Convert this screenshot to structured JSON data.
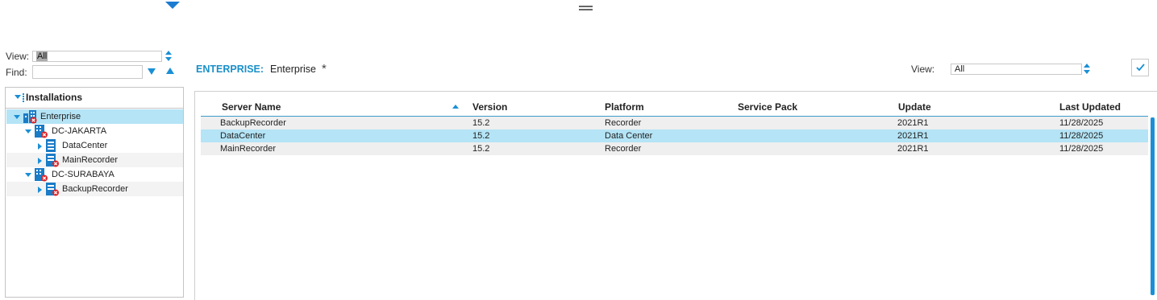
{
  "filter": {
    "view_label": "View:",
    "view_value": "All",
    "find_label": "Find:",
    "find_value": ""
  },
  "tree": {
    "title": "Installations",
    "nodes": [
      {
        "label": "Enterprise",
        "icon": "enterprise-icon",
        "state": "selected",
        "status": "error"
      },
      {
        "label": "DC-JAKARTA",
        "icon": "datacenter-icon",
        "status": "error"
      },
      {
        "label": "DataCenter",
        "icon": "server-icon",
        "status": "ok"
      },
      {
        "label": "MainRecorder",
        "icon": "server-icon",
        "status": "error"
      },
      {
        "label": "DC-SURABAYA",
        "icon": "datacenter-icon",
        "status": "error"
      },
      {
        "label": "BackupRecorder",
        "icon": "server-icon",
        "status": "error"
      }
    ]
  },
  "header": {
    "entity_type": "ENTERPRISE:",
    "entity_name": "Enterprise",
    "star": "*",
    "view_label": "View:",
    "view_value": "All"
  },
  "grid": {
    "columns": [
      "Server Name",
      "Version",
      "Platform",
      "Service Pack",
      "Update",
      "Last Updated"
    ],
    "sorted_column": "Server Name",
    "sort_direction": "ascending",
    "rows": [
      [
        "BackupRecorder",
        "15.2",
        "Recorder",
        "",
        "2021R1",
        "11/28/2025"
      ],
      [
        "DataCenter",
        "15.2",
        "Data Center",
        "",
        "2021R1",
        "11/28/2025"
      ],
      [
        "MainRecorder",
        "15.2",
        "Recorder",
        "",
        "2021R1",
        "11/28/2025"
      ]
    ],
    "selected_row": 1
  },
  "colors": {
    "accent": "#1a8fd6",
    "selected_row": "#b4e4f6",
    "error_badge": "#d9262b",
    "entity_label": "#1a90c8"
  }
}
